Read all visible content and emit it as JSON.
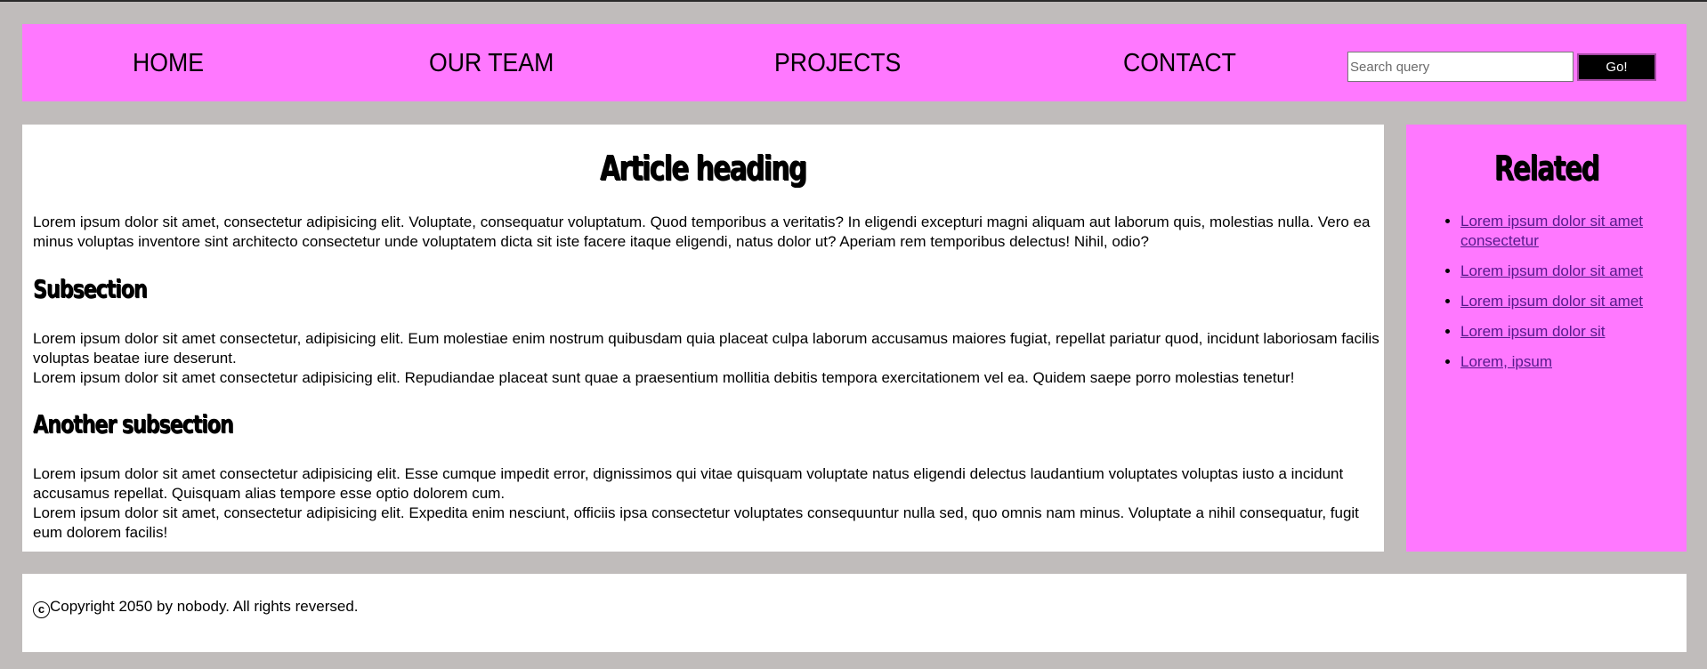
{
  "nav": {
    "items": [
      {
        "label": "HOME"
      },
      {
        "label": "OUR TEAM"
      },
      {
        "label": "PROJECTS"
      },
      {
        "label": "CONTACT"
      }
    ],
    "search": {
      "placeholder": "Search query",
      "value": ""
    },
    "go_label": "Go!"
  },
  "article": {
    "heading": "Article heading",
    "p1": "Lorem ipsum dolor sit amet, consectetur adipisicing elit. Voluptate, consequatur voluptatum. Quod temporibus a veritatis? In eligendi excepturi magni aliquam aut laborum quis, molestias nulla. Vero ea minus voluptas inventore sint architecto consectetur unde voluptatem dicta sit iste facere itaque eligendi, natus dolor ut? Aperiam rem temporibus delectus! Nihil, odio?",
    "subsection1": "Subsection",
    "p2": "Lorem ipsum dolor sit amet consectetur, adipisicing elit. Eum molestiae enim nostrum quibusdam quia placeat culpa laborum accusamus maiores fugiat, repellat pariatur quod, incidunt laboriosam facilis voluptas beatae iure deserunt.",
    "p3": "Lorem ipsum dolor sit amet consectetur adipisicing elit. Repudiandae placeat sunt quae a praesentium mollitia debitis tempora exercitationem vel ea. Quidem saepe porro molestias tenetur!",
    "subsection2": "Another subsection",
    "p4": "Lorem ipsum dolor sit amet consectetur adipisicing elit. Esse cumque impedit error, dignissimos qui vitae quisquam voluptate natus eligendi delectus laudantium voluptates voluptas iusto a incidunt accusamus repellat. Quisquam alias tempore esse optio dolorem cum.",
    "p5": "Lorem ipsum dolor sit amet, consectetur adipisicing elit. Expedita enim nesciunt, officiis ipsa consectetur voluptates consequuntur nulla sed, quo omnis nam minus. Voluptate a nihil consequatur, fugit eum dolorem facilis!"
  },
  "sidebar": {
    "heading": "Related",
    "links": [
      {
        "label": "Lorem ipsum dolor sit amet consectetur"
      },
      {
        "label": "Lorem ipsum dolor sit amet"
      },
      {
        "label": "Lorem ipsum dolor sit amet"
      },
      {
        "label": "Lorem ipsum dolor sit"
      },
      {
        "label": "Lorem, ipsum"
      }
    ]
  },
  "footer": {
    "copyright_symbol": "c",
    "text": "Copyright 2050 by nobody. All rights reversed."
  },
  "colors": {
    "page_background": "#c0bcbb",
    "accent_pink": "#ff78ff",
    "panel_white": "#ffffff",
    "link": "#551a8b",
    "button_black": "#000000"
  }
}
